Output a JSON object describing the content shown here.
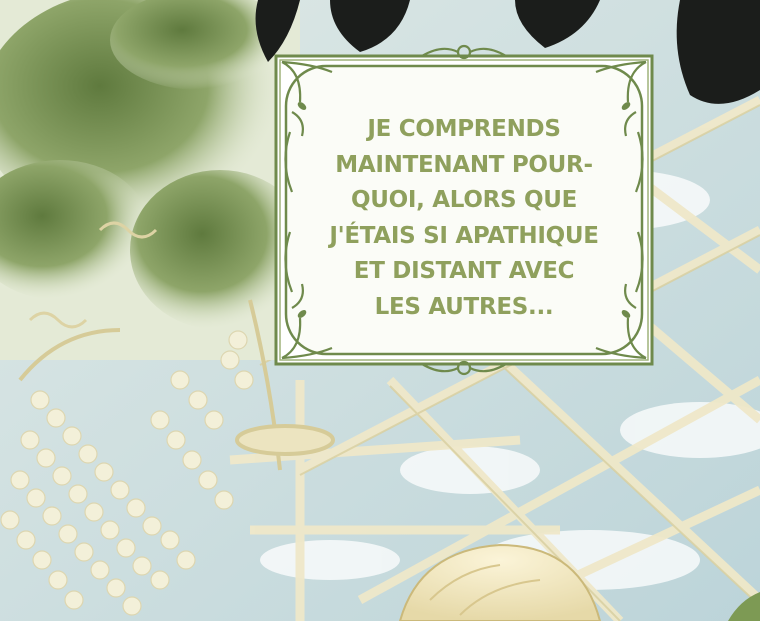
{
  "caption": {
    "lines": [
      "JE COMPRENDS",
      "MAINTENANT POUR-",
      "QUOI, ALORS QUE",
      "J'ÉTAIS SI APATHIQUE",
      "ET DISTANT AVEC",
      "LES AUTRES..."
    ],
    "text_color": "#8fa05d",
    "frame_color": "#6f8a4c"
  },
  "scene": {
    "sky_color": "#c9dde0",
    "foliage_color": "#6f8a4c",
    "pearl_color": "#f1efd7",
    "lattice_color": "#e9e2c0",
    "leaf_color": "#1a1c1a"
  }
}
